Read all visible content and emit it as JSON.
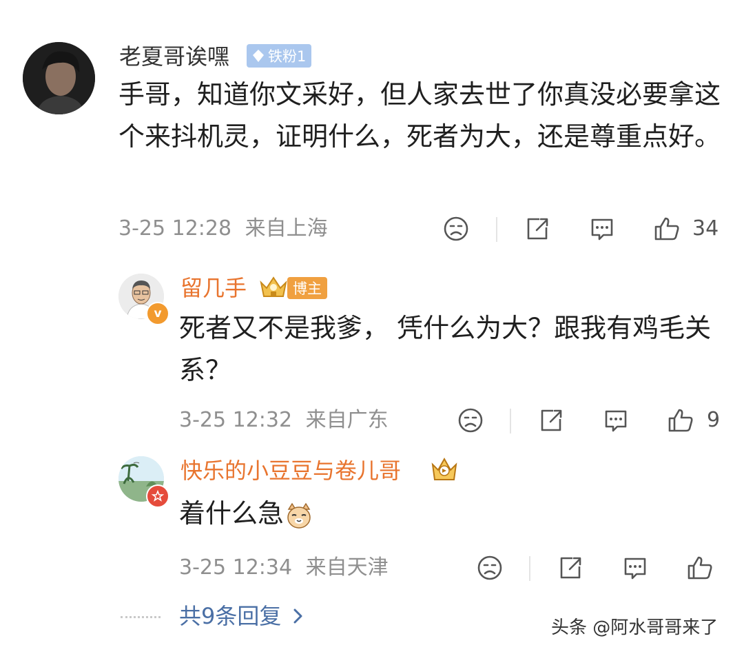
{
  "comments": [
    {
      "username": "老夏哥诶嘿",
      "fan_badge": "铁粉1",
      "text": "手哥，知道你文采好，但人家去世了你真没必要拿这个来抖机灵，证明什么，死者为大，还是尊重点好。",
      "time": "3-25 12:28",
      "location": "来自上海",
      "likes": "34"
    },
    {
      "username": "留几手",
      "role_badge": "博主",
      "avatar_badge": "v",
      "text": "死者又不是我爹， 凭什么为大？跟我有鸡毛关系？",
      "time": "3-25 12:32",
      "location": "来自广东",
      "likes": "9"
    },
    {
      "username": "快乐的小豆豆与卷儿哥",
      "text": "着什么急",
      "emoji": "cat-emoji",
      "time": "3-25 12:34",
      "location": "来自天津",
      "likes": ""
    }
  ],
  "more_replies": "共9条回复",
  "watermark": "头条 @阿水哥哥来了",
  "colors": {
    "orange_name": "#e8742e",
    "fan_badge_bg": "#aac7ee",
    "blogger_badge_bg": "#f0a040",
    "link_blue": "#4a6fa5"
  }
}
